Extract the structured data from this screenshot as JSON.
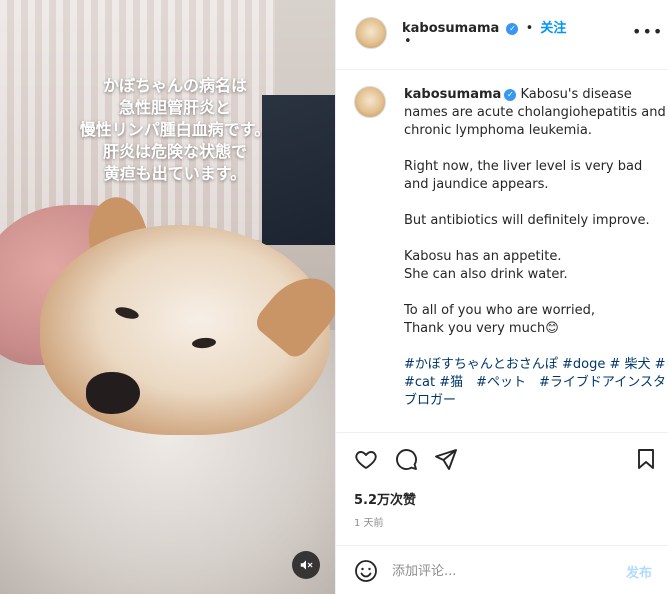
{
  "media": {
    "overlay_lines": [
      "かぼちゃんの病名は",
      "急性胆管肝炎と",
      "慢性リンパ腫白血病です。",
      "肝炎は危険な状態で",
      "黄疸も出ています。"
    ],
    "mute_icon": "speaker-muted-icon"
  },
  "header": {
    "username": "kabosumama",
    "verified_icon": "verified-badge-icon",
    "separator": "•",
    "follow_label": "关注",
    "dot": "•",
    "more_icon": "more-options-icon"
  },
  "caption": {
    "username": "kabosumama",
    "paragraphs": [
      "Kabosu's disease names are acute cholangiohepatitis and chronic lymphoma leukemia.",
      "Right now, the liver level is very bad and jaundice appears.",
      "But antibiotics will definitely improve.",
      "Kabosu has an appetite.",
      "She can also drink water.",
      "To all of you who are worried,",
      "Thank you very much😊"
    ],
    "hashtags": "#かぼすちゃんとおさんぽ #doge # 柴犬 # #cat #猫　#ペット　#ライブドアインスタブロガー"
  },
  "actions": {
    "like_icon": "heart-icon",
    "comment_icon": "comment-bubble-icon",
    "share_icon": "share-paper-plane-icon",
    "save_icon": "bookmark-icon",
    "likes": "5.2万次赞",
    "time": "1 天前"
  },
  "comment_box": {
    "emoji_icon": "emoji-smiley-icon",
    "placeholder": "添加评论...",
    "post_label": "发布"
  },
  "colors": {
    "accent": "#0095f6",
    "hashtag": "#00376b",
    "verified": "#3897f0",
    "post_disabled": "#b3dbff"
  }
}
